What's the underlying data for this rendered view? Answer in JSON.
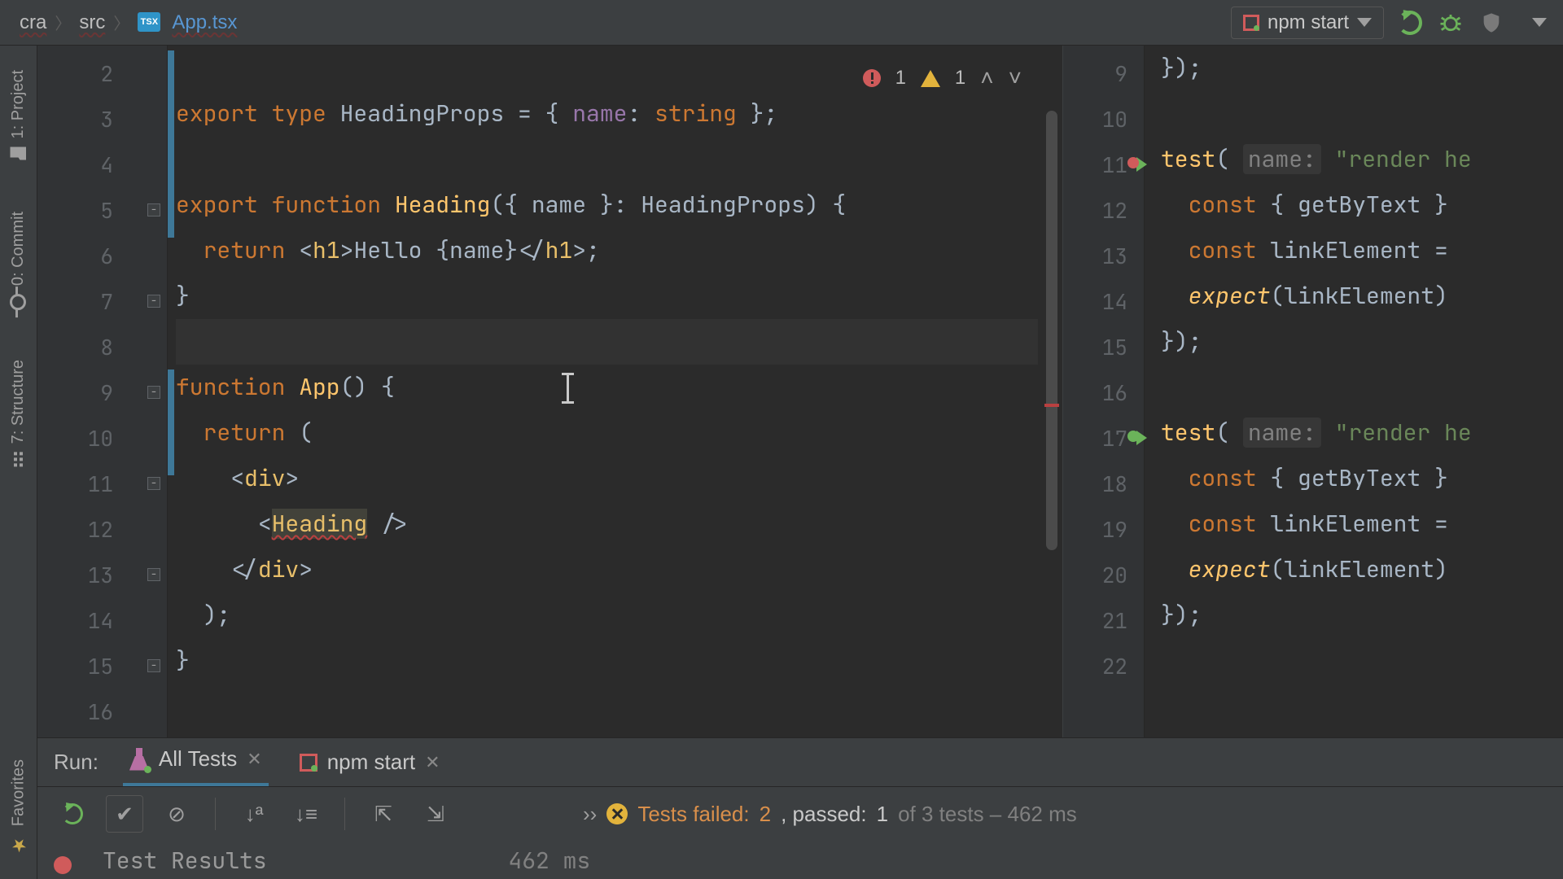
{
  "colors": {
    "bg": "#2b2b2b",
    "panel": "#3c3f41",
    "accent": "#3e7898",
    "error": "#d05b5b",
    "warn": "#e2b33c",
    "ok": "#6bb35a"
  },
  "breadcrumbs": {
    "root": "cra",
    "src": "src",
    "file": "App.tsx",
    "fileBadge": "TSX"
  },
  "runConfig": {
    "selected": "npm start"
  },
  "leftTools": {
    "project": "1: Project",
    "commit": "0: Commit",
    "structure": "7: Structure",
    "favorites": "Favorites"
  },
  "inspection": {
    "errors": "1",
    "warnings": "1"
  },
  "leftEditor": {
    "lineStart": 2,
    "lines": [
      {
        "n": 2,
        "html": ""
      },
      {
        "n": 3,
        "html": "<span class='k'>export type </span><span class='ty'>HeadingProps</span><span class='p'> = { </span><span class='pr'>name</span><span class='p'>: </span><span class='k'>string</span><span class='p'> };</span>"
      },
      {
        "n": 4,
        "html": ""
      },
      {
        "n": 5,
        "fold": "-",
        "html": "<span class='k'>export function </span><span class='fn'>Heading</span><span class='p'>({ </span><span class='id'>name</span><span class='p'> }: HeadingProps) {</span>"
      },
      {
        "n": 6,
        "html": "  <span class='k'>return </span><span class='p'>&lt;</span><span class='tag'>h1</span><span class='p'>&gt;Hello {</span><span class='id'>name</span><span class='p'>}&lt;/</span><span class='tag'>h1</span><span class='p'>&gt;;</span>"
      },
      {
        "n": 7,
        "fold": "-",
        "html": "<span class='p'>}</span>"
      },
      {
        "n": 8,
        "caret": true,
        "html": ""
      },
      {
        "n": 9,
        "fold": "-",
        "html": "<span class='k'>function </span><span class='fn'>App</span><span class='p'>() {</span>"
      },
      {
        "n": 10,
        "html": "  <span class='k'>return </span><span class='p'>(</span>"
      },
      {
        "n": 11,
        "fold": "-",
        "html": "    <span class='p'>&lt;</span><span class='tag'>div</span><span class='p'>&gt;</span>"
      },
      {
        "n": 12,
        "html": "      <span class='p'>&lt;</span><span class='tagu'>Heading</span><span class='p'> /&gt;</span>"
      },
      {
        "n": 13,
        "fold": "-",
        "html": "    <span class='p'>&lt;/</span><span class='tag'>div</span><span class='p'>&gt;</span>"
      },
      {
        "n": 14,
        "html": "  <span class='p'>);</span>"
      },
      {
        "n": 15,
        "fold": "-",
        "html": "<span class='p'>}</span>"
      },
      {
        "n": 16,
        "html": ""
      }
    ]
  },
  "rightEditor": {
    "lines": [
      {
        "n": 9,
        "html": "<span class='p'>});</span>"
      },
      {
        "n": 10,
        "html": ""
      },
      {
        "n": 11,
        "run": "red",
        "html": "<span class='fn'>test</span><span class='p'>( </span><span class='hint'>name:</span><span class='p'> </span><span class='str'>\"render he</span>"
      },
      {
        "n": 12,
        "html": "  <span class='k'>const </span><span class='p'>{ getByText }</span>"
      },
      {
        "n": 13,
        "html": "  <span class='k'>const </span><span class='id'>linkElement</span><span class='p'> =</span>"
      },
      {
        "n": 14,
        "html": "  <span class='it'>expect</span><span class='p'>(linkElement)</span>"
      },
      {
        "n": 15,
        "html": "<span class='p'>});</span>"
      },
      {
        "n": 16,
        "html": ""
      },
      {
        "n": 17,
        "run": "green",
        "html": "<span class='fn'>test</span><span class='p'>( </span><span class='hint'>name:</span><span class='p'> </span><span class='str'>\"render he</span>"
      },
      {
        "n": 18,
        "html": "  <span class='k'>const </span><span class='p'>{ getByText }</span>"
      },
      {
        "n": 19,
        "html": "  <span class='k'>const </span><span class='id'>linkElement</span><span class='p'> =</span>"
      },
      {
        "n": 20,
        "html": "  <span class='it'>expect</span><span class='p'>(linkElement)</span>"
      },
      {
        "n": 21,
        "html": "<span class='p'>});</span>"
      },
      {
        "n": 22,
        "html": ""
      }
    ]
  },
  "bottom": {
    "runLabel": "Run:",
    "tabs": [
      {
        "id": "alltests",
        "label": "All Tests",
        "icon": "flask",
        "active": true
      },
      {
        "id": "npmstart",
        "label": "npm start",
        "icon": "sq",
        "active": false
      }
    ],
    "status": {
      "chevrons": "››",
      "failedLabel": "Tests failed:",
      "failedCount": "2",
      "passedLabel": ", passed:",
      "passedCount": "1",
      "totalSuffix": "of 3 tests – 462 ms"
    },
    "testResultsLabel": "Test Results",
    "testResultsTime": "462 ms"
  }
}
